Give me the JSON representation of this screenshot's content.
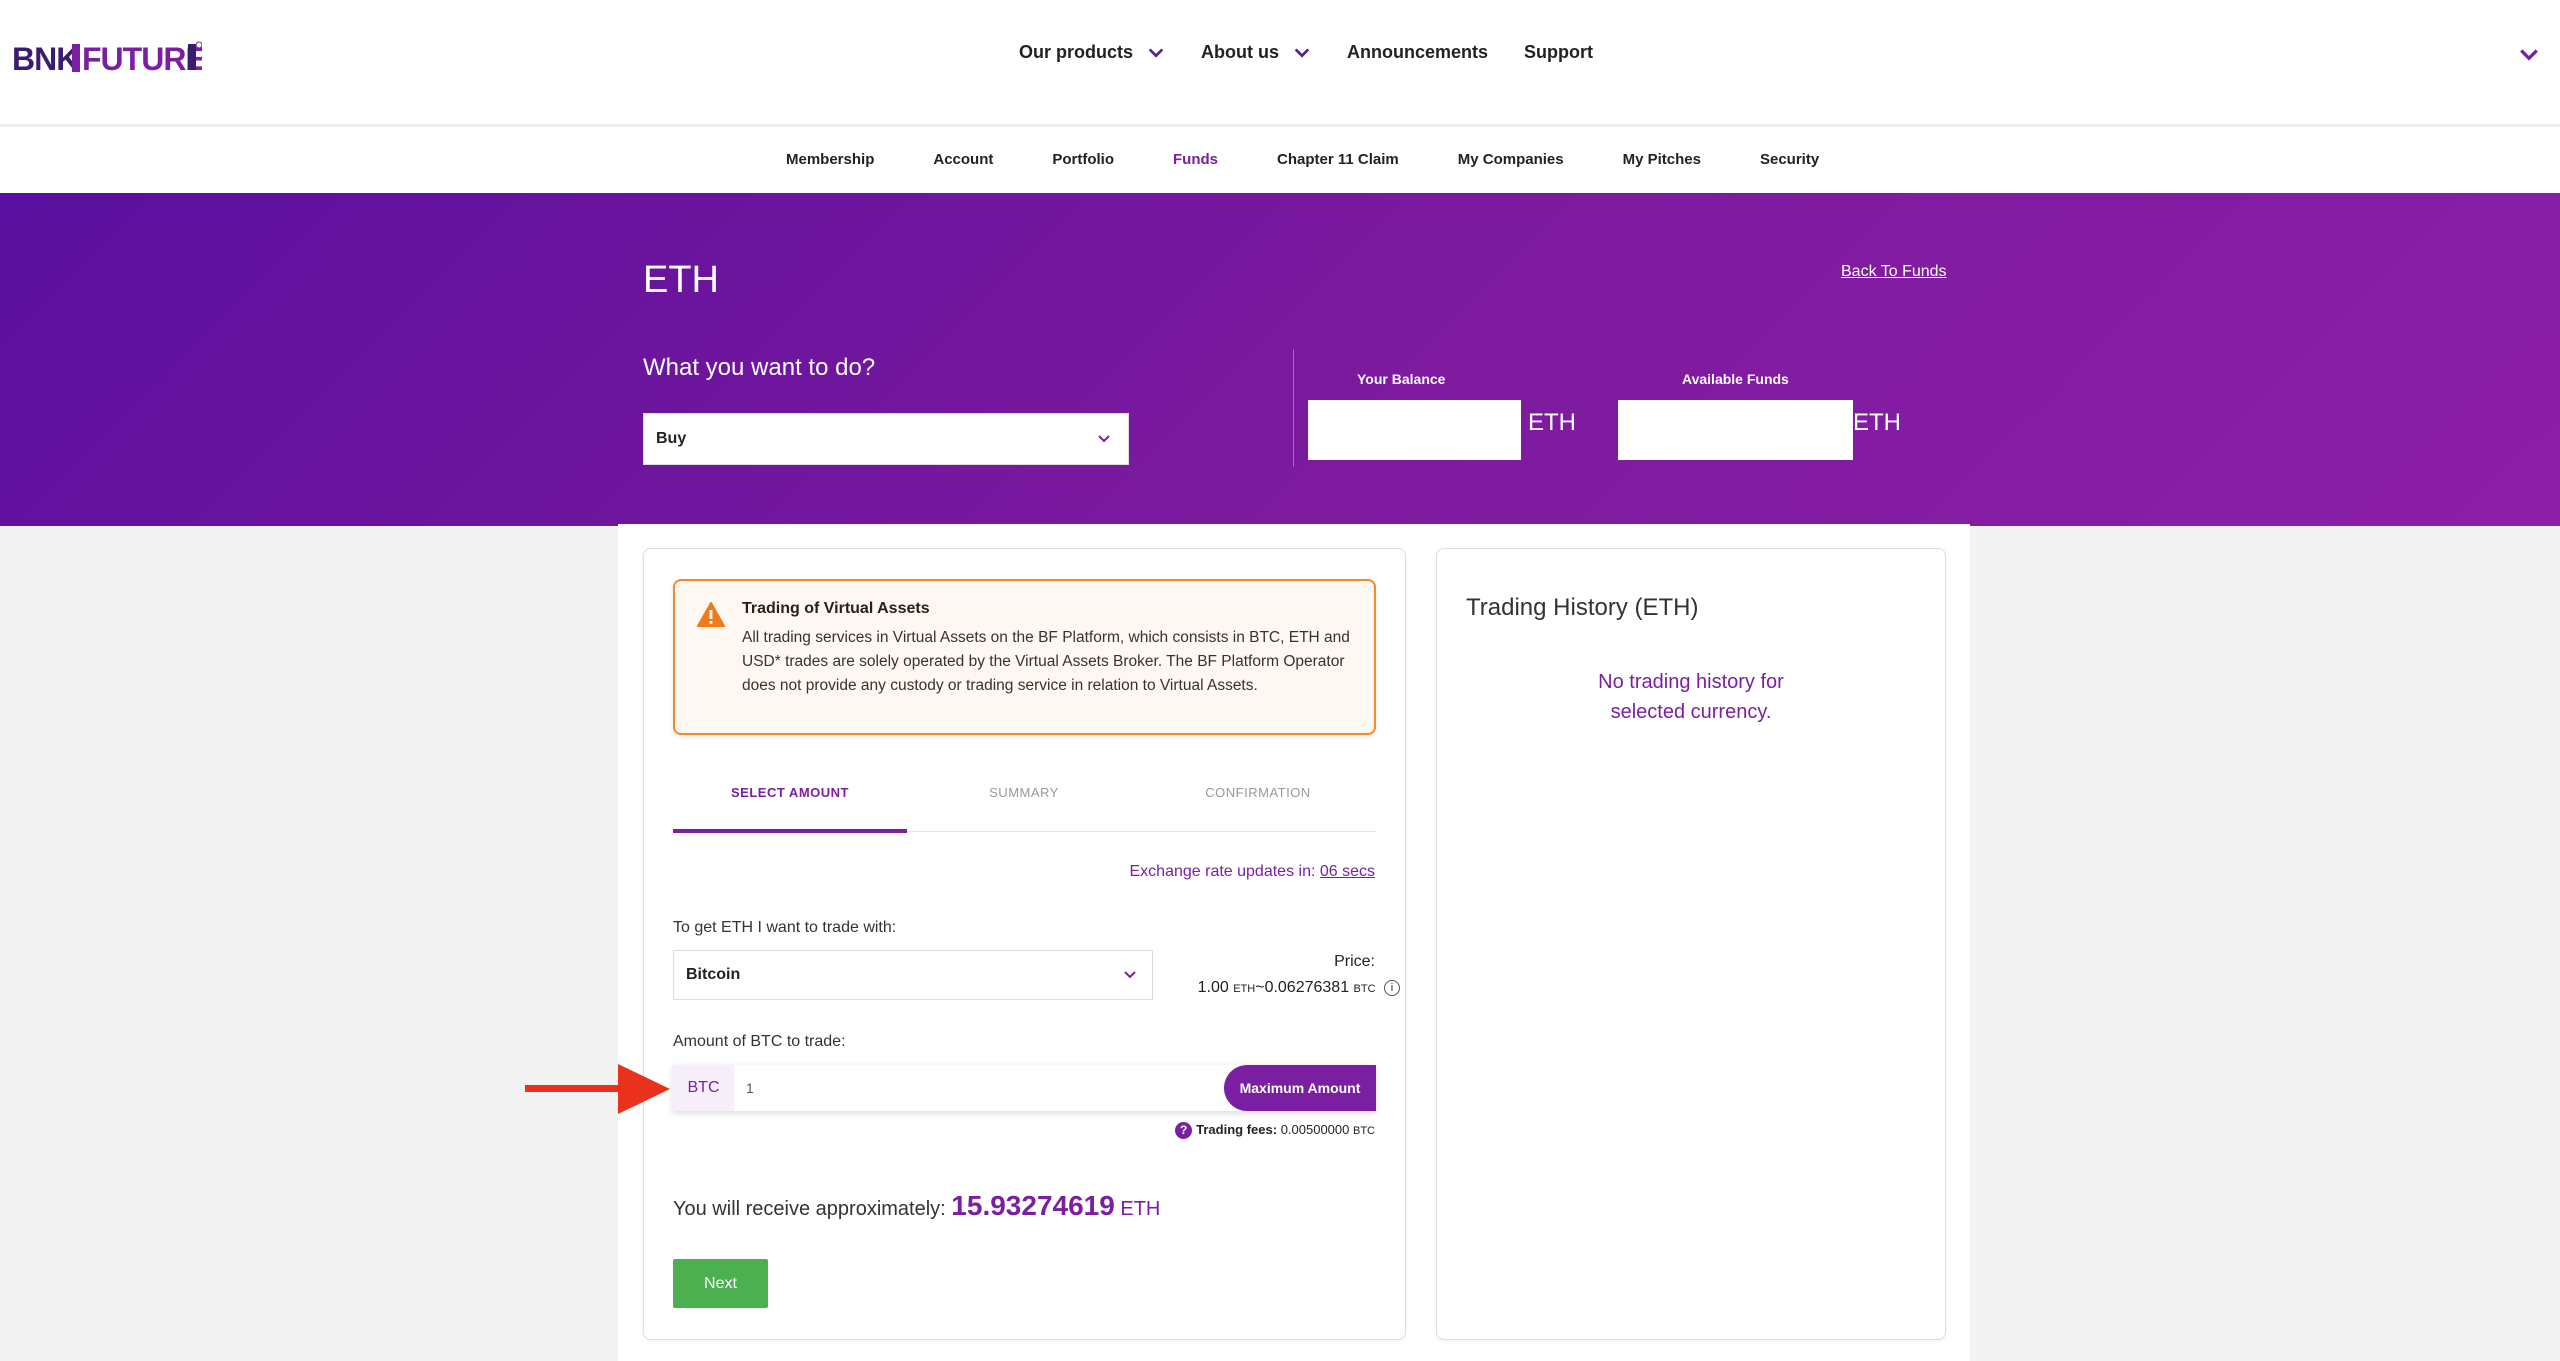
{
  "header": {
    "logo_text": "BNK TO THE FUTURE.COM",
    "nav": [
      {
        "label": "Our products",
        "has_dropdown": true
      },
      {
        "label": "About us",
        "has_dropdown": true
      },
      {
        "label": "Announcements",
        "has_dropdown": false
      },
      {
        "label": "Support",
        "has_dropdown": false
      }
    ]
  },
  "subnav": {
    "items": [
      {
        "label": "Membership",
        "active": false
      },
      {
        "label": "Account",
        "active": false
      },
      {
        "label": "Portfolio",
        "active": false
      },
      {
        "label": "Funds",
        "active": true
      },
      {
        "label": "Chapter 11 Claim",
        "active": false
      },
      {
        "label": "My Companies",
        "active": false
      },
      {
        "label": "My Pitches",
        "active": false
      },
      {
        "label": "Security",
        "active": false
      }
    ]
  },
  "hero": {
    "title": "ETH",
    "back_link": "Back To Funds",
    "question": "What you want to do?",
    "action_selected": "Buy",
    "balance_label": "Your Balance",
    "balance_currency": "ETH",
    "available_label": "Available Funds",
    "available_currency": "ETH"
  },
  "warning": {
    "title": "Trading of Virtual Assets",
    "text": "All trading services in Virtual Assets on the BF Platform, which consists in BTC, ETH and USD* trades are solely operated by the Virtual Assets Broker. The BF Platform Operator does not provide any custody or trading service in relation to Virtual Assets."
  },
  "steps": [
    "SELECT AMOUNT",
    "SUMMARY",
    "CONFIRMATION"
  ],
  "rate": {
    "label": "Exchange rate updates in:",
    "time": "06 secs"
  },
  "form": {
    "trade_with_label": "To get ETH I want to trade with:",
    "trade_with_value": "Bitcoin",
    "price_label": "Price:",
    "price_left": "1.00",
    "price_left_unit": "ETH",
    "price_sep": "~",
    "price_right": "0.06276381",
    "price_right_unit": "BTC",
    "amount_label": "Amount of BTC to trade:",
    "amount_prefix": "BTC",
    "amount_value": "1",
    "max_button": "Maximum Amount",
    "fees_label": "Trading fees:",
    "fees_value": "0.00500000",
    "fees_unit": "BTC",
    "receive_label": "You will receive approximately:",
    "receive_amount": "15.93274619",
    "receive_unit": "ETH",
    "next_button": "Next"
  },
  "history": {
    "title": "Trading History (ETH)",
    "empty_line1": "No trading history for",
    "empty_line2": "selected currency."
  },
  "colors": {
    "brand_purple": "#7b1fa2",
    "hero_start": "#5a0f9e",
    "hero_end": "#8c1fa8",
    "warning_orange": "#f08c2e",
    "next_green": "#4caf50",
    "arrow_red": "#e8321c"
  }
}
